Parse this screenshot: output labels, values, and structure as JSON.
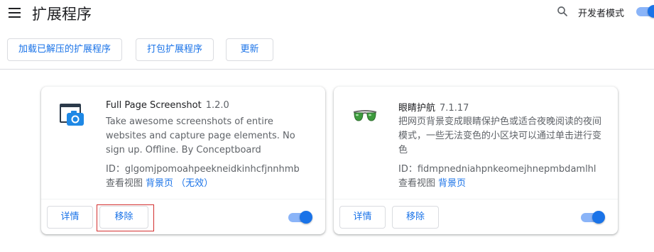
{
  "header": {
    "title": "扩展程序",
    "developer_mode_label": "开发者模式",
    "developer_mode_on": true
  },
  "toolbar": {
    "load_unpacked": "加载已解压的扩展程序",
    "pack_extension": "打包扩展程序",
    "update": "更新"
  },
  "extensions": [
    {
      "name": "Full Page Screenshot",
      "version": "1.2.0",
      "description": "Take awesome screenshots of entire websites and capture page elements. No sign up. Offline. By Conceptboard",
      "id_label": "ID：",
      "id": "glgomjpomoahpeekneidkinhcfjnnhmb",
      "inspect_label": "查看视图",
      "inspect_link": "背景页 （无效）",
      "details_label": "详情",
      "remove_label": "移除",
      "enabled": true,
      "icon": "camera-window-icon"
    },
    {
      "name": "眼睛护航",
      "version": "7.1.17",
      "description": "把网页背景变成眼睛保护色或适合夜晚阅读的夜间模式，一些无法变色的小区块可以通过单击进行变色",
      "id_label": "ID：",
      "id": "fidmpnedniahpnkeomejhnepmbdamlhl",
      "inspect_label": "查看视图",
      "inspect_link": "背景页",
      "details_label": "详情",
      "remove_label": "移除",
      "enabled": true,
      "icon": "green-sunglasses-icon"
    }
  ],
  "colors": {
    "accent": "#1a73e8",
    "toggle_track": "#8ab4f8",
    "highlight": "#d32f2f"
  }
}
